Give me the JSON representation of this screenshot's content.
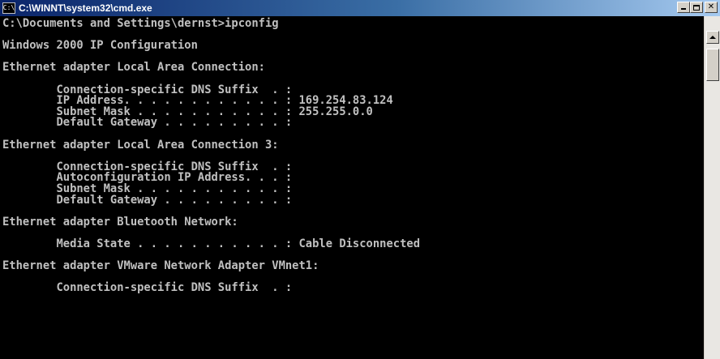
{
  "window": {
    "title": "C:\\WINNT\\system32\\cmd.exe",
    "icon_label": "C:\\"
  },
  "console": {
    "lines": [
      "C:\\Documents and Settings\\dernst>ipconfig",
      "",
      "Windows 2000 IP Configuration",
      "",
      "Ethernet adapter Local Area Connection:",
      "",
      "        Connection-specific DNS Suffix  . :",
      "        IP Address. . . . . . . . . . . . : 169.254.83.124",
      "        Subnet Mask . . . . . . . . . . . : 255.255.0.0",
      "        Default Gateway . . . . . . . . . :",
      "",
      "Ethernet adapter Local Area Connection 3:",
      "",
      "        Connection-specific DNS Suffix  . :",
      "        Autoconfiguration IP Address. . . :",
      "        Subnet Mask . . . . . . . . . . . :",
      "        Default Gateway . . . . . . . . . :",
      "",
      "Ethernet adapter Bluetooth Network:",
      "",
      "        Media State . . . . . . . . . . . : Cable Disconnected",
      "",
      "Ethernet adapter VMware Network Adapter VMnet1:",
      "",
      "        Connection-specific DNS Suffix  . :"
    ]
  },
  "colors": {
    "console_background": "#000000",
    "console_text": "#c0c0c0",
    "title_bar_start": "#0a246a",
    "title_bar_end": "#a6caf0"
  },
  "icons": [
    "cmd-icon",
    "minimize-icon",
    "maximize-icon",
    "close-icon",
    "scroll-up-arrow-icon"
  ]
}
